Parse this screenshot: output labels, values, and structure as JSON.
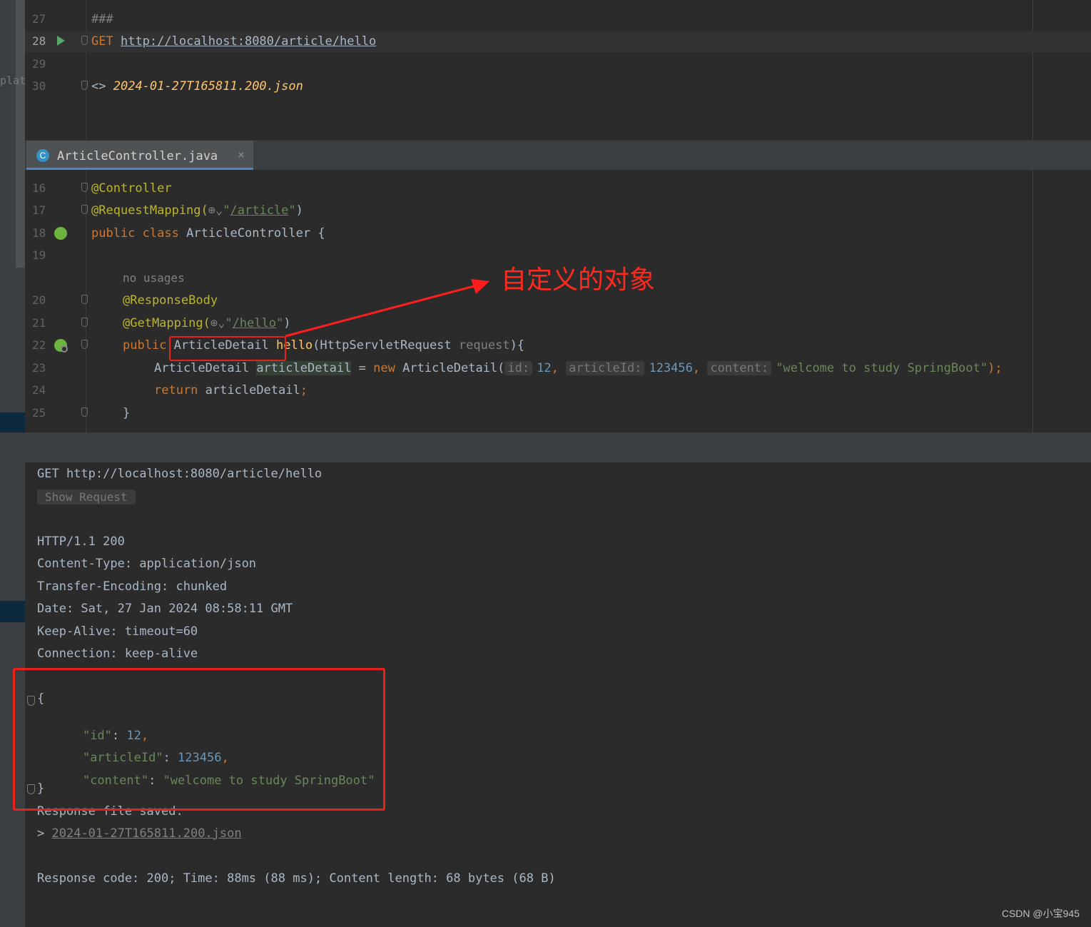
{
  "sidebar": {
    "partial_text": "plat"
  },
  "top_editor": {
    "lines": [
      {
        "num": "27",
        "text": "###"
      },
      {
        "num": "28",
        "method": "GET",
        "url": "http://localhost:8080/article/hello"
      },
      {
        "num": "29",
        "text": ""
      },
      {
        "num": "30",
        "prefix": "<>",
        "file": "2024-01-27T165811.200.json"
      }
    ]
  },
  "tab": {
    "icon": "C",
    "label": "ArticleController.java",
    "close": "×"
  },
  "java_editor": {
    "line_numbers": [
      "16",
      "17",
      "18",
      "19",
      "20",
      "21",
      "22",
      "23",
      "24",
      "25"
    ],
    "l16": {
      "annotation": "@Controller"
    },
    "l17": {
      "annotation": "@RequestMapping(",
      "icon": "⊕",
      "chev": "⌄",
      "q1": "\"",
      "path": "/article",
      "q2": "\"",
      "close": ")"
    },
    "l18": {
      "kw1": "public",
      "kw2": "class",
      "name": "ArticleController",
      "brace": "{"
    },
    "usages": "no usages",
    "l20": {
      "annotation": "@ResponseBody"
    },
    "l21": {
      "annotation": "@GetMapping(",
      "icon": "⊕",
      "chev": "⌄",
      "q1": "\"",
      "path": "/hello",
      "q2": "\"",
      "close": ")"
    },
    "l22": {
      "kw": "public",
      "type": "ArticleDetail",
      "method": "hello",
      "open": "(",
      "ptype": "HttpServletRequest",
      "pname": "request",
      "tail": "){"
    },
    "l23": {
      "type": "ArticleDetail",
      "var": "articleDetail",
      "eq": "=",
      "kw": "new",
      "ctor": "ArticleDetail(",
      "h1": "id:",
      "v1": "12",
      "c1": ",",
      "h2": "articleId:",
      "v2": "123456",
      "c2": ",",
      "h3": "content:",
      "v3": "\"welcome to study SpringBoot\"",
      "end": ");"
    },
    "l24": {
      "kw": "return",
      "var": "articleDetail",
      "semi": ";"
    },
    "l25": {
      "brace": "}"
    }
  },
  "annotation_label": "自定义的对象",
  "output": {
    "request_line": "GET http://localhost:8080/article/hello",
    "show_request": "Show Request",
    "headers": [
      "HTTP/1.1 200",
      "Content-Type: application/json",
      "Transfer-Encoding: chunked",
      "Date: Sat, 27 Jan 2024 08:58:11 GMT",
      "Keep-Alive: timeout=60",
      "Connection: keep-alive"
    ],
    "json": {
      "open": "{",
      "rows": [
        {
          "key": "\"id\"",
          "colon": ": ",
          "value": "12",
          "comma": ",",
          "kind": "num"
        },
        {
          "key": "\"articleId\"",
          "colon": ": ",
          "value": "123456",
          "comma": ",",
          "kind": "num"
        },
        {
          "key": "\"content\"",
          "colon": ": ",
          "value": "\"welcome to study SpringBoot\"",
          "comma": "",
          "kind": "str"
        }
      ],
      "close": "}"
    },
    "saved_text": "Response file saved.",
    "saved_prefix": ">",
    "saved_file": "2024-01-27T165811.200.json",
    "summary": "Response code: 200; Time: 88ms (88 ms); Content length: 68 bytes (68 B)"
  },
  "watermark": "CSDN @小宝945"
}
